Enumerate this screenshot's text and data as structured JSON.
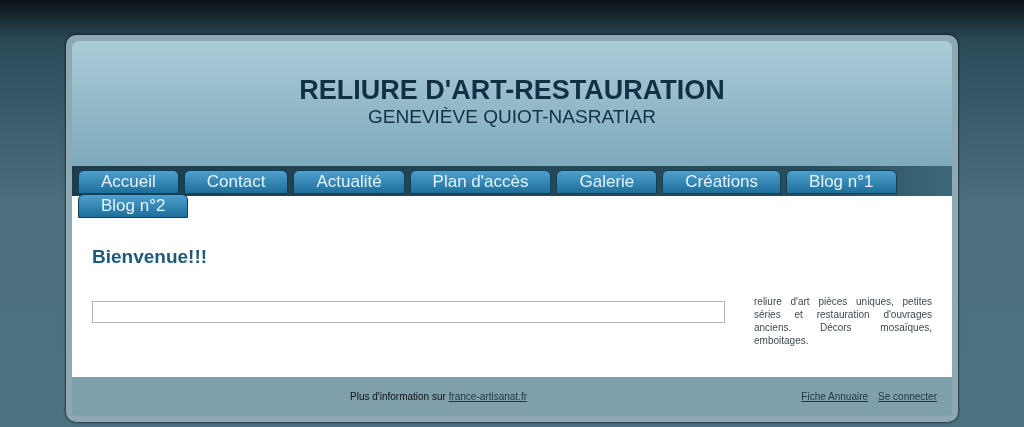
{
  "header": {
    "title": "RELIURE D'ART-RESTAURATION",
    "subtitle": "GENEVIÈVE QUIOT-NASRATIAR"
  },
  "nav": [
    {
      "label": "Accueil",
      "selected": false
    },
    {
      "label": "Contact",
      "selected": false
    },
    {
      "label": "Actualité",
      "selected": false
    },
    {
      "label": "Plan d'accès",
      "selected": false
    },
    {
      "label": "Galerie",
      "selected": false
    },
    {
      "label": "Créations",
      "selected": false
    },
    {
      "label": "Blog n°1",
      "selected": false
    },
    {
      "label": "Blog n°2",
      "selected": false
    }
  ],
  "content": {
    "heading": "Bienvenue!!!",
    "description": "reliure d'art pièces uniques, petites séries et restauration d'ouvrages anciens. Décors mosaïques, emboitages."
  },
  "footer": {
    "info_text": "Plus d'information sur",
    "info_link": "france-artisanat.fr",
    "links": [
      "Fiche Annuaire",
      "Se connecter"
    ]
  }
}
